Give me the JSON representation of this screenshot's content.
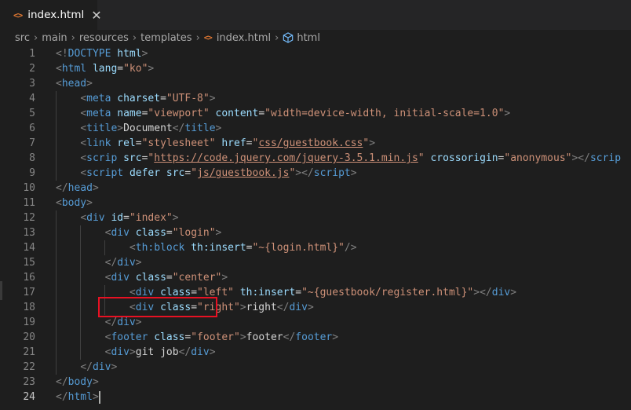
{
  "tab": {
    "icon": "<>",
    "title": "index.html",
    "close": "✕"
  },
  "breadcrumb": {
    "items": [
      "src",
      "main",
      "resources",
      "templates"
    ],
    "file": "index.html",
    "symbol": "html"
  },
  "highlight_color": "#e81123",
  "lines": [
    {
      "n": "1",
      "tokens": [
        [
          "p",
          "<!"
        ],
        [
          "t",
          "DOCTYPE"
        ],
        [
          "tx",
          " "
        ],
        [
          "a",
          "html"
        ],
        [
          "p",
          ">"
        ]
      ]
    },
    {
      "n": "2",
      "tokens": [
        [
          "p",
          "<"
        ],
        [
          "t",
          "html"
        ],
        [
          "tx",
          " "
        ],
        [
          "a",
          "lang"
        ],
        [
          "tx",
          "="
        ],
        [
          "s",
          "\"ko\""
        ],
        [
          "p",
          ">"
        ]
      ]
    },
    {
      "n": "3",
      "tokens": [
        [
          "p",
          "<"
        ],
        [
          "t",
          "head"
        ],
        [
          "p",
          ">"
        ]
      ]
    },
    {
      "n": "4",
      "tokens": [
        [
          "tx",
          "    "
        ],
        [
          "p",
          "<"
        ],
        [
          "t",
          "meta"
        ],
        [
          "tx",
          " "
        ],
        [
          "a",
          "charset"
        ],
        [
          "tx",
          "="
        ],
        [
          "s",
          "\"UTF-8\""
        ],
        [
          "p",
          ">"
        ]
      ]
    },
    {
      "n": "5",
      "tokens": [
        [
          "tx",
          "    "
        ],
        [
          "p",
          "<"
        ],
        [
          "t",
          "meta"
        ],
        [
          "tx",
          " "
        ],
        [
          "a",
          "name"
        ],
        [
          "tx",
          "="
        ],
        [
          "s",
          "\"viewport\""
        ],
        [
          "tx",
          " "
        ],
        [
          "a",
          "content"
        ],
        [
          "tx",
          "="
        ],
        [
          "s",
          "\"width=device-width, initial-scale=1.0\""
        ],
        [
          "p",
          ">"
        ]
      ]
    },
    {
      "n": "6",
      "tokens": [
        [
          "tx",
          "    "
        ],
        [
          "p",
          "<"
        ],
        [
          "t",
          "title"
        ],
        [
          "p",
          ">"
        ],
        [
          "tx",
          "Document"
        ],
        [
          "p",
          "</"
        ],
        [
          "t",
          "title"
        ],
        [
          "p",
          ">"
        ]
      ]
    },
    {
      "n": "7",
      "tokens": [
        [
          "tx",
          "    "
        ],
        [
          "p",
          "<"
        ],
        [
          "t",
          "link"
        ],
        [
          "tx",
          " "
        ],
        [
          "a",
          "rel"
        ],
        [
          "tx",
          "="
        ],
        [
          "s",
          "\"stylesheet\""
        ],
        [
          "tx",
          " "
        ],
        [
          "a",
          "href"
        ],
        [
          "tx",
          "="
        ],
        [
          "s",
          "\""
        ],
        [
          "su",
          "css/guestbook.css"
        ],
        [
          "s",
          "\""
        ],
        [
          "p",
          ">"
        ]
      ]
    },
    {
      "n": "8",
      "tokens": [
        [
          "tx",
          "    "
        ],
        [
          "p",
          "<"
        ],
        [
          "t",
          "scrip"
        ],
        [
          "tx",
          " "
        ],
        [
          "a",
          "src"
        ],
        [
          "tx",
          "="
        ],
        [
          "s",
          "\""
        ],
        [
          "su",
          "https://code.jquery.com/jquery-3.5.1.min.js"
        ],
        [
          "s",
          "\""
        ],
        [
          "tx",
          " "
        ],
        [
          "a",
          "crossorigin"
        ],
        [
          "tx",
          "="
        ],
        [
          "s",
          "\"anonymous\""
        ],
        [
          "p",
          "></"
        ],
        [
          "t",
          "scrip"
        ]
      ]
    },
    {
      "n": "9",
      "tokens": [
        [
          "tx",
          "    "
        ],
        [
          "p",
          "<"
        ],
        [
          "t",
          "script"
        ],
        [
          "tx",
          " "
        ],
        [
          "a",
          "defer"
        ],
        [
          "tx",
          " "
        ],
        [
          "a",
          "src"
        ],
        [
          "tx",
          "="
        ],
        [
          "s",
          "\""
        ],
        [
          "su",
          "js/guestbook.js"
        ],
        [
          "s",
          "\""
        ],
        [
          "p",
          "></"
        ],
        [
          "t",
          "script"
        ],
        [
          "p",
          ">"
        ]
      ]
    },
    {
      "n": "10",
      "tokens": [
        [
          "p",
          "</"
        ],
        [
          "t",
          "head"
        ],
        [
          "p",
          ">"
        ]
      ]
    },
    {
      "n": "11",
      "tokens": [
        [
          "p",
          "<"
        ],
        [
          "t",
          "body"
        ],
        [
          "p",
          ">"
        ]
      ]
    },
    {
      "n": "12",
      "tokens": [
        [
          "tx",
          "    "
        ],
        [
          "p",
          "<"
        ],
        [
          "t",
          "div"
        ],
        [
          "tx",
          " "
        ],
        [
          "a",
          "id"
        ],
        [
          "tx",
          "="
        ],
        [
          "s",
          "\"index\""
        ],
        [
          "p",
          ">"
        ]
      ]
    },
    {
      "n": "13",
      "tokens": [
        [
          "tx",
          "        "
        ],
        [
          "p",
          "<"
        ],
        [
          "t",
          "div"
        ],
        [
          "tx",
          " "
        ],
        [
          "a",
          "class"
        ],
        [
          "tx",
          "="
        ],
        [
          "s",
          "\"login\""
        ],
        [
          "p",
          ">"
        ]
      ]
    },
    {
      "n": "14",
      "tokens": [
        [
          "tx",
          "            "
        ],
        [
          "p",
          "<"
        ],
        [
          "t",
          "th:block"
        ],
        [
          "tx",
          " "
        ],
        [
          "a",
          "th:insert"
        ],
        [
          "tx",
          "="
        ],
        [
          "s",
          "\"~{login.html}\""
        ],
        [
          "p",
          "/>"
        ]
      ]
    },
    {
      "n": "15",
      "tokens": [
        [
          "tx",
          "        "
        ],
        [
          "p",
          "</"
        ],
        [
          "t",
          "div"
        ],
        [
          "p",
          ">"
        ]
      ]
    },
    {
      "n": "16",
      "tokens": [
        [
          "tx",
          "        "
        ],
        [
          "p",
          "<"
        ],
        [
          "t",
          "div"
        ],
        [
          "tx",
          " "
        ],
        [
          "a",
          "class"
        ],
        [
          "tx",
          "="
        ],
        [
          "s",
          "\"center\""
        ],
        [
          "p",
          ">"
        ]
      ]
    },
    {
      "n": "17",
      "tokens": [
        [
          "tx",
          "            "
        ],
        [
          "p",
          "<"
        ],
        [
          "t",
          "div"
        ],
        [
          "tx",
          " "
        ],
        [
          "a",
          "class"
        ],
        [
          "tx",
          "="
        ],
        [
          "s",
          "\"left\""
        ],
        [
          "tx",
          " "
        ],
        [
          "a",
          "th:insert"
        ],
        [
          "tx",
          "="
        ],
        [
          "s",
          "\"~{guestbook/register.html}\""
        ],
        [
          "p",
          "></"
        ],
        [
          "t",
          "div"
        ],
        [
          "p",
          ">"
        ]
      ]
    },
    {
      "n": "18",
      "tokens": [
        [
          "tx",
          "            "
        ],
        [
          "p",
          "<"
        ],
        [
          "t",
          "div"
        ],
        [
          "tx",
          " "
        ],
        [
          "a",
          "class"
        ],
        [
          "tx",
          "="
        ],
        [
          "s",
          "\"right\""
        ],
        [
          "p",
          ">"
        ],
        [
          "tx",
          "right"
        ],
        [
          "p",
          "</"
        ],
        [
          "t",
          "div"
        ],
        [
          "p",
          ">"
        ]
      ]
    },
    {
      "n": "19",
      "tokens": [
        [
          "tx",
          "        "
        ],
        [
          "p",
          "</"
        ],
        [
          "t",
          "div"
        ],
        [
          "p",
          ">"
        ]
      ]
    },
    {
      "n": "20",
      "tokens": [
        [
          "tx",
          "        "
        ],
        [
          "p",
          "<"
        ],
        [
          "t",
          "footer"
        ],
        [
          "tx",
          " "
        ],
        [
          "a",
          "class"
        ],
        [
          "tx",
          "="
        ],
        [
          "s",
          "\"footer\""
        ],
        [
          "p",
          ">"
        ],
        [
          "tx",
          "footer"
        ],
        [
          "p",
          "</"
        ],
        [
          "t",
          "footer"
        ],
        [
          "p",
          ">"
        ]
      ]
    },
    {
      "n": "21",
      "tokens": [
        [
          "tx",
          "        "
        ],
        [
          "p",
          "<"
        ],
        [
          "t",
          "div"
        ],
        [
          "p",
          ">"
        ],
        [
          "tx",
          "git job"
        ],
        [
          "p",
          "</"
        ],
        [
          "t",
          "div"
        ],
        [
          "p",
          ">"
        ]
      ]
    },
    {
      "n": "22",
      "tokens": [
        [
          "tx",
          "    "
        ],
        [
          "p",
          "</"
        ],
        [
          "t",
          "div"
        ],
        [
          "p",
          ">"
        ]
      ]
    },
    {
      "n": "23",
      "tokens": [
        [
          "p",
          "</"
        ],
        [
          "t",
          "body"
        ],
        [
          "p",
          ">"
        ]
      ]
    },
    {
      "n": "24",
      "tokens": [
        [
          "p",
          "</"
        ],
        [
          "t",
          "html"
        ],
        [
          "p",
          ">"
        ]
      ],
      "active": true
    }
  ]
}
